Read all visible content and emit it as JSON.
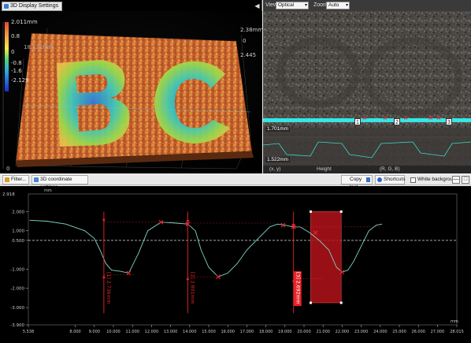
{
  "panel3d": {
    "tab_label": "3D Display Settings",
    "collapse_glyph": "◀",
    "colorbar": {
      "top": "2.011mm",
      "ticks": [
        "0.8",
        "0",
        "-0.8",
        "-1.6",
        "-2.129"
      ]
    },
    "axis_labels": {
      "z_left": "18.132mm",
      "z_right_top": "2.38mm",
      "z_right_mid": "0",
      "z_right_low": "2.445",
      "x_origin": "0"
    },
    "letters": [
      "B",
      "C"
    ]
  },
  "optical": {
    "view_label": "View",
    "view_value": "Optical",
    "zoom_label": "Zoom",
    "zoom_value": "Auto",
    "marker_labels": [
      "1",
      "2",
      "3"
    ],
    "profile_top_label": "1.701mm",
    "profile_bottom_label": "1.522mm",
    "status": {
      "xy": "(x, y)",
      "height": "Height",
      "rgb": "(R, G, B)"
    }
  },
  "lower_toolbar": {
    "filter_label": "Filter...",
    "coord_settings_label": "3D coordinate settings...",
    "copy_label": "Copy tool...",
    "shortcuts_label": "Shortcuts",
    "white_bg_label": "White background",
    "minimize_glyph": "—",
    "maximize_glyph": "□"
  },
  "colors": {
    "profile_line": "#7fd6c8",
    "marker_red": "#e8232a",
    "highlight_box": "#b3131a",
    "laser_line": "#35e6e6"
  },
  "chart_data": {
    "type": "line",
    "title": "",
    "y_unit_label": "mm",
    "x_unit_label": "mm",
    "y_top_label": "2.918",
    "y_bottom_label": "-3.900",
    "ylim": [
      -3.9,
      2.918
    ],
    "xlim": [
      5.538,
      28.015
    ],
    "x_ticks": [
      "5.538",
      "8.000",
      "9.000",
      "10.000",
      "11.000",
      "12.000",
      "13.000",
      "14.000",
      "15.000",
      "16.000",
      "17.000",
      "18.000",
      "19.000",
      "20.000",
      "21.000",
      "22.000",
      "23.000",
      "24.000",
      "25.000",
      "26.000",
      "27.000",
      "28.015"
    ],
    "y_ticks": [
      "2.000",
      "1.000",
      "0.500",
      "-1.000",
      "-2.000",
      "-3.000",
      "-3.900"
    ],
    "reference_level": 0.5,
    "series": [
      {
        "x": [
          5.6,
          6.5,
          7.5,
          8.5,
          9.0,
          9.3,
          9.6,
          9.9,
          10.3,
          10.8,
          11.3,
          11.8,
          12.5,
          13.3,
          13.9,
          14.3,
          14.6,
          15.0,
          15.5,
          16.0,
          16.5,
          17.0,
          17.6,
          18.2,
          18.6,
          19.0,
          19.4,
          19.8,
          20.3,
          20.8,
          21.3,
          21.7,
          22.0,
          22.3,
          22.6,
          23.0,
          23.4,
          23.8,
          24.1
        ],
        "y": [
          1.55,
          1.5,
          1.35,
          1.0,
          0.6,
          0.0,
          -0.7,
          -1.05,
          -1.1,
          -1.2,
          -0.2,
          1.0,
          1.45,
          1.4,
          1.35,
          1.0,
          0.0,
          -0.9,
          -1.4,
          -1.2,
          -0.7,
          0.0,
          0.6,
          1.2,
          1.35,
          1.3,
          1.2,
          1.2,
          0.9,
          0.5,
          0.0,
          -0.9,
          -1.15,
          -1.05,
          -0.6,
          0.2,
          1.0,
          1.3,
          1.35
        ]
      }
    ],
    "measurements": [
      {
        "label": "[1] 2.736mm",
        "x": 9.5,
        "y_top": 1.45,
        "y_bottom": -1.3
      },
      {
        "label": "[2] 2.801mm",
        "x": 13.9,
        "y_top": 1.4,
        "y_bottom": -1.4
      },
      {
        "label": "[3] 2.692mm",
        "x": 19.45,
        "y_top": 1.2,
        "y_bottom": -1.5
      }
    ],
    "x_markers": [
      {
        "x": 10.8,
        "y": -1.2
      },
      {
        "x": 12.5,
        "y": 1.45
      },
      {
        "x": 13.9,
        "y": 1.35
      },
      {
        "x": 15.5,
        "y": -1.4
      },
      {
        "x": 18.9,
        "y": 1.3
      },
      {
        "x": 19.45,
        "y": 1.2
      },
      {
        "x": 20.6,
        "y": 0.9
      },
      {
        "x": 22.0,
        "y": -1.15
      }
    ],
    "highlight_region": {
      "x0": 20.35,
      "x1": 21.95,
      "y0": -2.75,
      "y1": 2.0
    }
  }
}
